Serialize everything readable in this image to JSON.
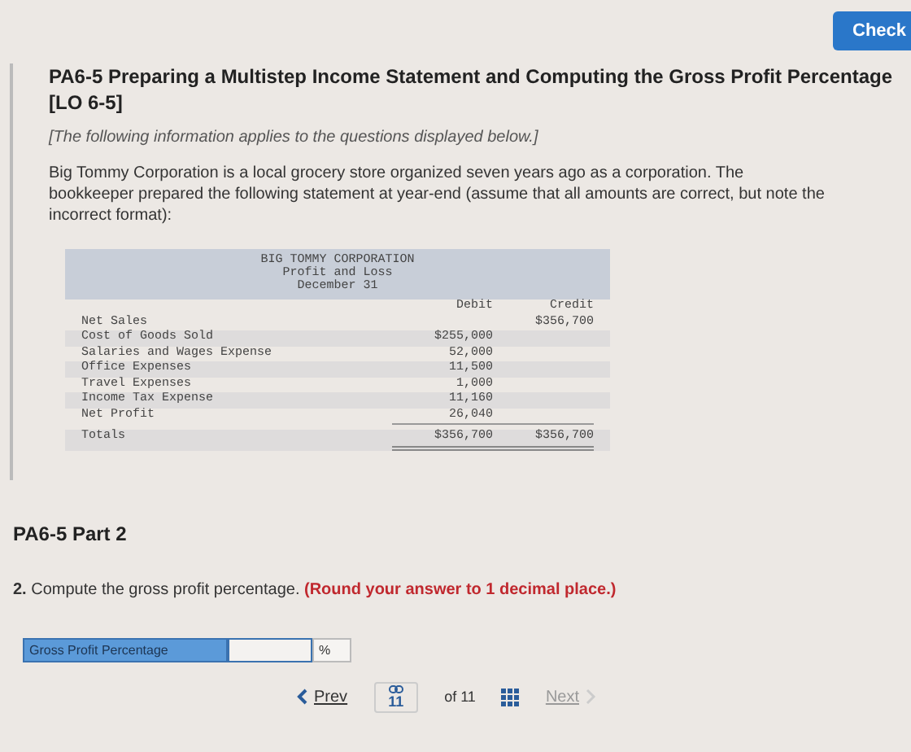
{
  "header": {
    "check_button": "Check"
  },
  "question": {
    "title": "PA6-5 Preparing a Multistep Income Statement and Computing the Gross Profit Percentage [LO 6-5]",
    "note": "[The following information applies to the questions displayed below.]",
    "intro": "Big Tommy Corporation is a local grocery store organized seven years ago as a corporation. The bookkeeper prepared the following statement at year-end (assume that all amounts are correct, but note the incorrect format):",
    "statement": {
      "title_lines": [
        "BIG TOMMY CORPORATION",
        "Profit and Loss",
        "December 31"
      ],
      "columns": [
        "Debit",
        "Credit"
      ],
      "rows": [
        {
          "kind": "line",
          "label": "Net Sales",
          "credit": "$356,700"
        },
        {
          "kind": "line",
          "label": "Cost of Goods Sold",
          "debit": "$255,000"
        },
        {
          "kind": "line",
          "label": "Salaries and Wages Expense",
          "debit": "52,000"
        },
        {
          "kind": "line",
          "label": "Office Expenses",
          "debit": "11,500"
        },
        {
          "kind": "line",
          "label": "Travel Expenses",
          "debit": "1,000"
        },
        {
          "kind": "line",
          "label": "Income Tax Expense",
          "debit": "11,160"
        },
        {
          "kind": "line",
          "label": "Net Profit",
          "debit": "26,040"
        },
        {
          "kind": "total",
          "label": "Totals",
          "debit": "$356,700",
          "credit": "$356,700"
        }
      ]
    }
  },
  "part2": {
    "title": "PA6-5 Part 2",
    "number": "2.",
    "prompt": "Compute the gross profit percentage.",
    "emphasis": "(Round your answer to 1 decimal place.)",
    "answer": {
      "label": "Gross Profit Percentage",
      "unit": "%"
    }
  },
  "pager": {
    "prev": "Prev",
    "page": "11",
    "of": "of 11",
    "next": "Next",
    "next_disabled": true
  }
}
